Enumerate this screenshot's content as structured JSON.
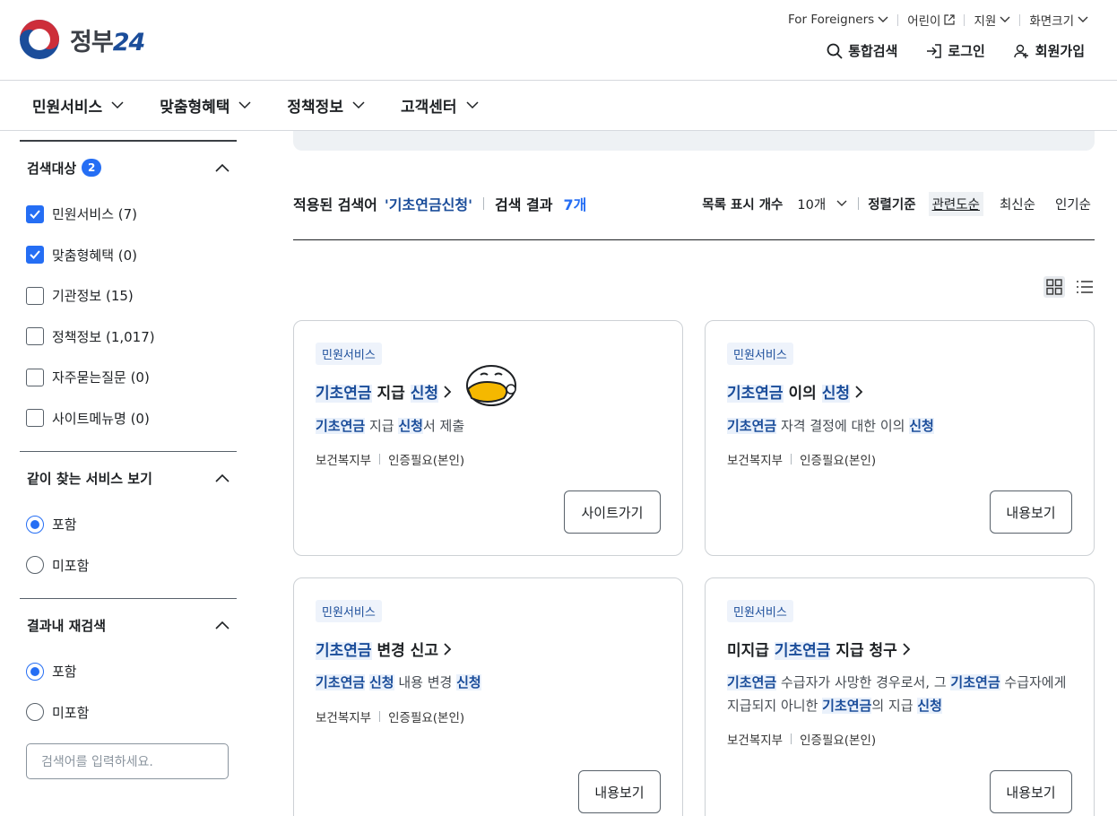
{
  "header": {
    "logo_text": "정부",
    "logo_num": "24",
    "util": [
      "For Foreigners",
      "어린이",
      "지원",
      "화면크기"
    ],
    "actions": {
      "search": "통합검색",
      "login": "로그인",
      "signup": "회원가입"
    }
  },
  "gnb": [
    "민원서비스",
    "맞춤형혜택",
    "정책정보",
    "고객센터"
  ],
  "sidebar": {
    "target": {
      "title": "검색대상",
      "badge": "2",
      "options": [
        {
          "label": "민원서비스 (7)",
          "checked": true
        },
        {
          "label": "맞춤형혜택 (0)",
          "checked": true
        },
        {
          "label": "기관정보 (15)",
          "checked": false
        },
        {
          "label": "정책정보 (1,017)",
          "checked": false
        },
        {
          "label": "자주묻는질문 (0)",
          "checked": false
        },
        {
          "label": "사이트메뉴명 (0)",
          "checked": false
        }
      ]
    },
    "together": {
      "title": "같이 찾는 서비스 보기",
      "include": "포함",
      "exclude": "미포함"
    },
    "research": {
      "title": "결과내 재검색",
      "include": "포함",
      "exclude": "미포함",
      "placeholder": "검색어를 입력하세요."
    }
  },
  "result": {
    "applied_label": "적용된 검색어",
    "keyword": "'기초연금신청'",
    "count_label": "검색 결과",
    "count": "7개",
    "per_page_label": "목록 표시 개수",
    "per_page": "10개",
    "sort_label": "정렬기준",
    "sorts": [
      "관련도순",
      "최신순",
      "인기순"
    ]
  },
  "cards": [
    {
      "tag": "민원서비스",
      "title": [
        "기초연금",
        " 지급 ",
        "신청"
      ],
      "desc": [
        "기초연금",
        " 지급 ",
        "신청",
        "서 제출"
      ],
      "org": "보건복지부",
      "auth": "인증필요(본인)",
      "button": "사이트가기"
    },
    {
      "tag": "민원서비스",
      "title": [
        "기초연금",
        " 이의 ",
        "신청"
      ],
      "desc": [
        "기초연금",
        " 자격 결정에 대한 이의 ",
        "신청"
      ],
      "org": "보건복지부",
      "auth": "인증필요(본인)",
      "button": "내용보기"
    },
    {
      "tag": "민원서비스",
      "title": [
        "기초연금",
        " 변경 신고"
      ],
      "desc": [
        "기초연금",
        " ",
        "신청",
        " 내용 변경 ",
        "신청"
      ],
      "org": "보건복지부",
      "auth": "인증필요(본인)",
      "button": "내용보기"
    },
    {
      "tag": "민원서비스",
      "title": [
        "미지급 ",
        "기초연금",
        " 지급 청구"
      ],
      "desc": [
        "기초연금",
        " 수급자가 사망한 경우로서, 그 ",
        "기초연금",
        " 수급자에게 지급되지 아니한 ",
        "기초연금",
        "의 지급 ",
        "신청"
      ],
      "org": "보건복지부",
      "auth": "인증필요(본인)",
      "button": "내용보기"
    }
  ]
}
